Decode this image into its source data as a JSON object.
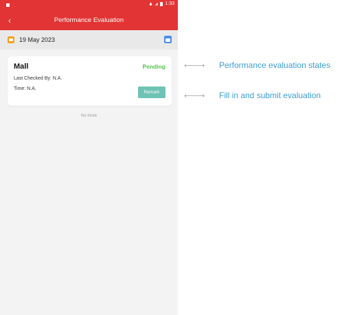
{
  "status_bar": {
    "time": "1:33"
  },
  "header": {
    "title": "Performance Evaluation",
    "back_icon": "chevron-left-icon"
  },
  "date_bar": {
    "date": "19 May 2023",
    "left_icon": "calendar-icon",
    "right_icon": "calendar-picker-icon"
  },
  "card": {
    "title": "Mall",
    "status": "Pending",
    "last_checked": "Last Checked By: N.A.",
    "time": "Time: N.A.",
    "remark_label": "Remark",
    "status_color": "#55c24f"
  },
  "list_footer": "No more",
  "annotations": [
    {
      "arrow": "⟵⟶",
      "text": "Performance evaluation states"
    },
    {
      "arrow": "⟵⟶",
      "text": "Fill in and submit evaluation"
    }
  ],
  "colors": {
    "appbar": "#e23434",
    "accent_button": "#6fc3b5",
    "annotation_text": "#3b9fd6"
  }
}
